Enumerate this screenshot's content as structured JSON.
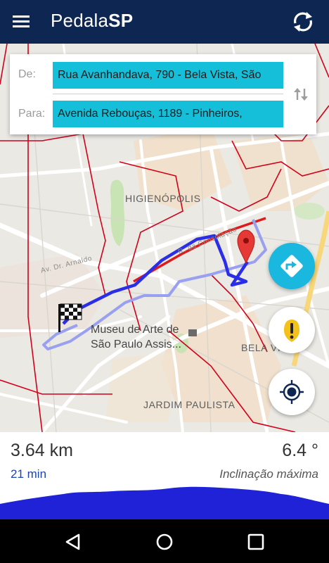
{
  "app": {
    "title_light": "Pedala",
    "title_bold": "SP"
  },
  "route": {
    "from_label": "De:",
    "from_value": "Rua Avanhandava, 790 - Bela Vista, São",
    "to_label": "Para:",
    "to_value": "Avenida Rebouças, 1189 - Pinheiros,"
  },
  "map": {
    "labels": {
      "higienopolis": "HIGIENÓPOLIS",
      "museum_line1": "Museu de Arte de",
      "museum_line2": "São Paulo Assis...",
      "bela_vista": "BELA VIS",
      "jardim_paulista": "JARDIM PAULISTA",
      "av_dr_arnaldo": "Av. Dr. Arnaldo",
      "consolacao": "R. da Consolação"
    },
    "colors": {
      "route_primary": "#2a2ee6",
      "route_alternative": "#9aa0f0",
      "bike_lane": "#e01a1a",
      "pin": "#e53935"
    }
  },
  "summary": {
    "distance": "3.64 km",
    "duration": "21 min",
    "max_incline": "6.4 °",
    "max_incline_label": "Inclinação máxima"
  },
  "icons": {
    "menu": "menu-icon",
    "refresh": "refresh-icon",
    "swap": "swap-vertical-icon",
    "navigate": "navigation-icon",
    "alert": "alert-icon",
    "locate": "my-location-icon",
    "back": "back-icon",
    "home": "home-icon",
    "recents": "recents-icon"
  },
  "theme": {
    "header": "#0e2752",
    "field": "#15bfd9",
    "accent": "#1ab7de",
    "elevation": "#1f22d6"
  }
}
